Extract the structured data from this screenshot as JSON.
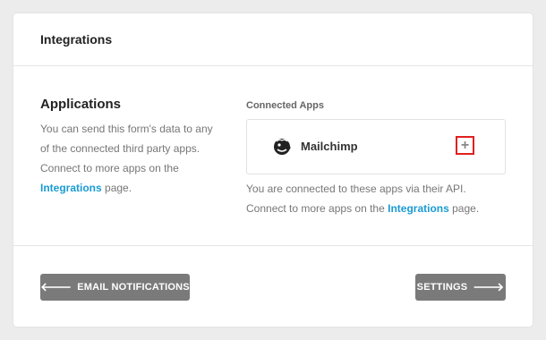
{
  "header": {
    "title": "Integrations"
  },
  "applications": {
    "title": "Applications",
    "desc_1": "You can send this form's data to any of the connected third party apps. Connect to more apps on the",
    "link": "Integrations",
    "desc_2": "page."
  },
  "connected": {
    "label": "Connected Apps",
    "apps": [
      {
        "name": "Mailchimp",
        "icon": "mailchimp-icon",
        "add_symbol": "+"
      }
    ],
    "info_1": "You are connected to these apps via their API. Connect to more apps on the",
    "info_link": "Integrations",
    "info_2": "page."
  },
  "footer": {
    "prev_arrow": "🡐",
    "prev_label": "EMAIL NOTIFICATIONS",
    "next_label": "SETTINGS",
    "next_arrow": "🡒"
  },
  "colors": {
    "link": "#1a9bd3",
    "button": "#7a7a7a",
    "highlight": "#e02020"
  }
}
